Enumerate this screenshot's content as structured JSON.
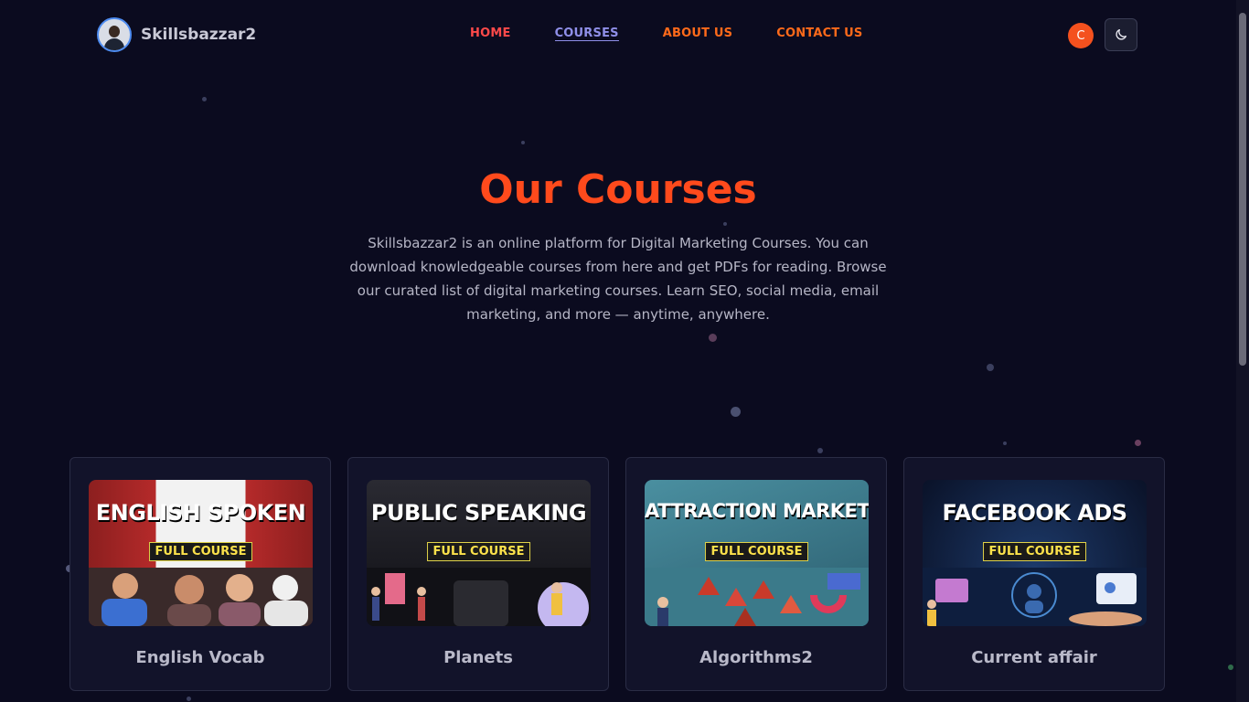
{
  "brand": {
    "name": "Skillsbazzar2",
    "avatar_icon": "user-photo-icon"
  },
  "nav": {
    "items": [
      {
        "label": "HOME",
        "color": "#ff4a4a"
      },
      {
        "label": "COURSES",
        "color": "#8f8fe8",
        "active": true
      },
      {
        "label": "ABOUT US",
        "color": "#ff6a1a"
      },
      {
        "label": "CONTACT US",
        "color": "#ff6a1a"
      }
    ]
  },
  "user": {
    "initial": "C",
    "color": "#f4511e"
  },
  "theme_toggle": {
    "icon": "moon-icon"
  },
  "hero": {
    "title": "Our Courses",
    "description": "Skillsbazzar2 is an online platform for Digital Marketing Courses. You can download knowledgeable courses from here and get PDFs for reading. Browse our curated list of digital marketing courses. Learn SEO, social media, email marketing, and more — anytime, anywhere."
  },
  "courses": [
    {
      "title": "English Vocab",
      "thumb_line1": "ENGLISH SPOKEN",
      "thumb_line2": "FULL COURSE",
      "bg": "#7a1d1d"
    },
    {
      "title": "Planets",
      "thumb_line1": "PUBLIC SPEAKING",
      "thumb_line2": "FULL COURSE",
      "bg": "#1a1a1f"
    },
    {
      "title": "Algorithms2",
      "thumb_line1": "ATTRACTION MARKETING",
      "thumb_line2": "FULL COURSE",
      "bg": "#2f6a78"
    },
    {
      "title": "Current affair",
      "thumb_line1": "FACEBOOK ADS",
      "thumb_line2": "FULL COURSE",
      "bg": "#0f1e3d"
    }
  ],
  "colors": {
    "background": "#0b0b1f",
    "accent": "#ff4a1c",
    "card_bg": "#12132a"
  }
}
